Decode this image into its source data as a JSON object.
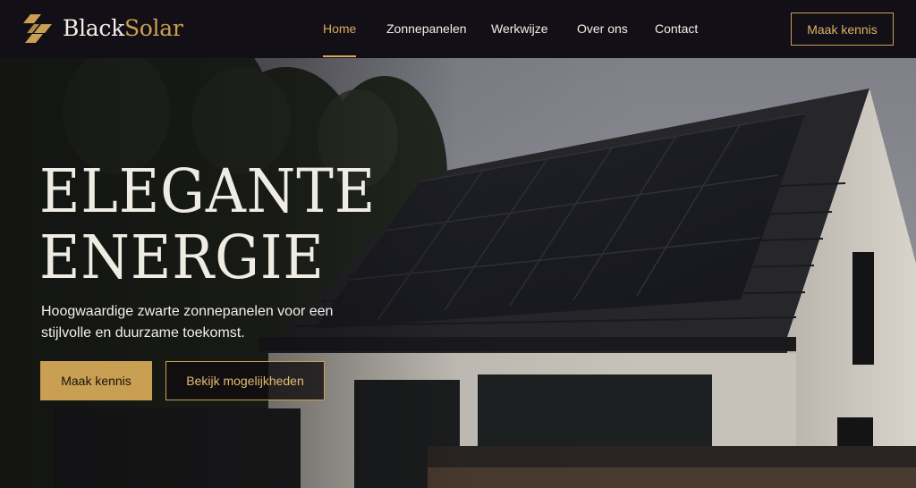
{
  "brand": {
    "name_part1": "Black",
    "name_part2": "Solar",
    "icon": "solar-bolt-logo"
  },
  "nav": {
    "items": [
      {
        "label": "Home",
        "active": true
      },
      {
        "label": "Zonnepanelen",
        "active": false
      },
      {
        "label": "Werkwijze",
        "active": false
      },
      {
        "label": "Over ons",
        "active": false
      },
      {
        "label": "Contact",
        "active": false
      }
    ],
    "cta_label": "Maak kennis"
  },
  "hero": {
    "headline_line1": "ELEGANTE",
    "headline_line2": "ENERGIE",
    "lead": "Hoogwaardige zwarte zonnepanelen voor een stijlvolle en duurzame toekomst.",
    "primary_cta": "Maak kennis",
    "secondary_cta": "Bekijk mogelijkheden",
    "image": "house-with-black-solar-panels"
  },
  "colors": {
    "accent": "#c9a053",
    "header_bg": "#130f16",
    "text_light": "#efece4"
  }
}
